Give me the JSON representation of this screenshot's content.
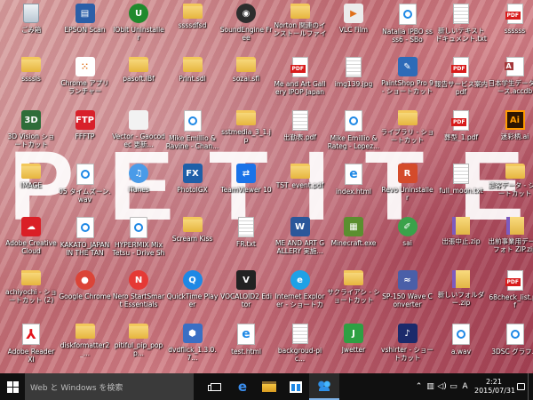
{
  "wallpaper": {
    "letters": [
      "P",
      "E",
      "T",
      "I",
      "T",
      "E"
    ]
  },
  "desktop": {
    "icons": [
      {
        "label": "ごみ箱",
        "glyph": "recycle-bin-icon",
        "style": "g-recycle",
        "text": ""
      },
      {
        "label": "EPSON Scan",
        "glyph": "scanner-icon",
        "style": "g-square",
        "color": "#2b5fa8",
        "text": "▤"
      },
      {
        "label": "IObit Uninstaller",
        "glyph": "iobit-uninstaller-icon",
        "style": "g-round",
        "color": "#1f8a2c",
        "text": "U"
      },
      {
        "label": "ssssdfsd",
        "glyph": "folder-icon",
        "style": "g-folder",
        "text": ""
      },
      {
        "label": "SoundEngine Free",
        "glyph": "soundengine-icon",
        "style": "g-round",
        "color": "#2d2d2d",
        "text": "◉"
      },
      {
        "label": "Norton 関連のイ ンストールファイル",
        "glyph": "folder-icon",
        "style": "g-folder",
        "text": ""
      },
      {
        "label": "VLC Film",
        "glyph": "vlc-file-icon",
        "style": "g-square",
        "color": "#ececec",
        "text": "▶"
      },
      {
        "label": "Natalia IPBO ssss6 - SBo",
        "glyph": "media-file-icon",
        "style": "g-media",
        "text": ""
      },
      {
        "label": "新しいテキスト ドキュメント.txt",
        "glyph": "text-file-icon",
        "style": "g-doc",
        "text": ""
      },
      {
        "label": "ssssss",
        "glyph": "pdf-file-icon",
        "style": "g-pdf",
        "text": ""
      },
      {
        "label": "ssssls",
        "glyph": "folder-icon",
        "style": "g-folder",
        "text": ""
      },
      {
        "label": "Chrome アプリ ランチャー",
        "glyph": "app-launcher-icon",
        "style": "g-square",
        "color": "#ffffff",
        "text": "⁙"
      },
      {
        "label": "pasoft.lBf",
        "glyph": "folder-icon",
        "style": "g-folder",
        "text": ""
      },
      {
        "label": "Print.sdl",
        "glyph": "folder-icon",
        "style": "g-folder",
        "text": ""
      },
      {
        "label": "sozai.sfl",
        "glyph": "folder-icon",
        "style": "g-folder",
        "text": ""
      },
      {
        "label": "Me and Art Gallery IPOP Japan voice...",
        "glyph": "pdf-file-icon",
        "style": "g-pdf",
        "text": ""
      },
      {
        "label": "img139.jpg",
        "glyph": "image-file-icon",
        "style": "g-doc",
        "text": ""
      },
      {
        "label": "PaintShop Pro 9 - ショートカット",
        "glyph": "paintshop-pro-icon",
        "style": "g-square",
        "color": "#2d6bb8",
        "text": "✎"
      },
      {
        "label": "報告サービス案内 pdf",
        "glyph": "pdf-file-icon",
        "style": "g-pdf",
        "text": ""
      },
      {
        "label": "日本学生データベース.accdb",
        "glyph": "access-file-icon",
        "style": "g-access",
        "text": ""
      },
      {
        "label": "3D Vision ショートカット",
        "glyph": "3d-vision-icon",
        "style": "g-square",
        "color": "#2f6d39",
        "text": "3D"
      },
      {
        "label": "FFFTP",
        "glyph": "ffftp-icon",
        "style": "g-square",
        "color": "#d8202a",
        "text": "FTP"
      },
      {
        "label": "Vector - Gaocodec 更新...",
        "glyph": "web-shortcut-icon",
        "style": "g-square",
        "color": "#f2f2f2",
        "text": ""
      },
      {
        "label": "Mike Emillio & Ravine - Chan...",
        "glyph": "media-file-icon",
        "style": "g-media",
        "text": ""
      },
      {
        "label": "sstmedia_3_1.jp",
        "glyph": "folder-icon",
        "style": "g-folder",
        "text": ""
      },
      {
        "label": "出勤表.pdf",
        "glyph": "text-file-icon",
        "style": "g-doc",
        "text": ""
      },
      {
        "label": "Mike Emillio & Rateg - Lopez...",
        "glyph": "media-file-icon",
        "style": "g-media",
        "text": ""
      },
      {
        "label": "ライブラリ - ショートカット",
        "glyph": "libraries-icon",
        "style": "g-folder",
        "text": ""
      },
      {
        "label": "葬型_1.pdf",
        "glyph": "pdf-file-icon",
        "style": "g-pdf",
        "text": ""
      },
      {
        "label": "迷彩柄.ai",
        "glyph": "illustrator-file-icon",
        "style": "g-ai",
        "text": "Ai"
      },
      {
        "label": "IMAGE",
        "glyph": "folder-icon",
        "style": "g-folder",
        "text": ""
      },
      {
        "label": "05 タイムズーン.wav",
        "glyph": "media-file-icon",
        "style": "g-media",
        "text": ""
      },
      {
        "label": "iTunes",
        "glyph": "itunes-icon",
        "style": "g-round",
        "color": "#4a9be8",
        "text": "♫"
      },
      {
        "label": "PhotoIGX",
        "glyph": "photo-app-icon",
        "style": "g-square",
        "color": "#1f5fa8",
        "text": "FX"
      },
      {
        "label": "TeamViewer 10",
        "glyph": "teamviewer-icon",
        "style": "g-square",
        "color": "#1a73e8",
        "text": "⇄"
      },
      {
        "label": "TST_event.pdf",
        "glyph": "folder-icon",
        "style": "g-folder",
        "text": ""
      },
      {
        "label": "index.html",
        "glyph": "web-file-icon",
        "style": "g-html",
        "text": "e"
      },
      {
        "label": "Revo Uninstaller",
        "glyph": "revo-uninstaller-icon",
        "style": "g-square",
        "color": "#d44b2b",
        "text": "R"
      },
      {
        "label": "full_moon.txt",
        "glyph": "text-file-icon",
        "style": "g-doc",
        "text": ""
      },
      {
        "label": "顧客データ - ショートカット",
        "glyph": "folder-icon",
        "style": "g-folder",
        "text": ""
      },
      {
        "label": "Adobe Creative Cloud",
        "glyph": "creative-cloud-icon",
        "style": "g-square",
        "color": "#da1f26",
        "text": "☁"
      },
      {
        "label": "KAKATO_JAPAN IN THE TAN",
        "glyph": "media-file-icon",
        "style": "g-media",
        "text": ""
      },
      {
        "label": "HYPERMIX Mix Tetsu - Drive Sho...",
        "glyph": "media-file-icon",
        "style": "g-media",
        "text": ""
      },
      {
        "label": "Scream Kiss",
        "glyph": "folder-icon",
        "style": "g-folder",
        "text": ""
      },
      {
        "label": "FR.txt",
        "glyph": "text-file-icon",
        "style": "g-doc",
        "text": ""
      },
      {
        "label": "ME AND ART GALLERY 実施...",
        "glyph": "word-file-icon",
        "style": "g-square",
        "color": "#2b579a",
        "text": "W"
      },
      {
        "label": "Minecraft.exe",
        "glyph": "minecraft-icon",
        "style": "g-square",
        "color": "#5b8f2f",
        "text": "▦"
      },
      {
        "label": "sai",
        "glyph": "sai-app-icon",
        "style": "g-round",
        "color": "#3aa24a",
        "text": "✐"
      },
      {
        "label": "出張中止.zip",
        "glyph": "zip-file-icon",
        "style": "g-zip",
        "text": ""
      },
      {
        "label": "出前事業用データフォト ZIP.zip",
        "glyph": "zip-file-icon",
        "style": "g-zip",
        "text": ""
      },
      {
        "label": "achiyochi - ショートカット (2)",
        "glyph": "folder-icon",
        "style": "g-folder",
        "text": ""
      },
      {
        "label": "Google Chrome",
        "glyph": "chrome-icon",
        "style": "g-round",
        "color": "#db4437",
        "text": "●"
      },
      {
        "label": "Nero StartSmart Essentials",
        "glyph": "nero-icon",
        "style": "g-round",
        "color": "#e53935",
        "text": "N"
      },
      {
        "label": "QuickTime Player",
        "glyph": "quicktime-icon",
        "style": "g-round",
        "color": "#1e88e5",
        "text": "Q"
      },
      {
        "label": "VOCALOID2 Editor",
        "glyph": "vocaloid-icon",
        "style": "g-square",
        "color": "#222222",
        "text": "V"
      },
      {
        "label": "Internet Explorer - ショートカット",
        "glyph": "internet-explorer-icon",
        "style": "g-round",
        "color": "#1ea1e6",
        "text": "e"
      },
      {
        "label": "サクライアシ - ショートカット",
        "glyph": "folder-icon",
        "style": "g-folder",
        "text": ""
      },
      {
        "label": "SP-150 Wave Converter",
        "glyph": "converter-icon",
        "style": "g-square",
        "color": "#4a5fa8",
        "text": "≈"
      },
      {
        "label": "新しいフォルダー.zip",
        "glyph": "zip-file-icon",
        "style": "g-zip",
        "text": ""
      },
      {
        "label": "68check_list.pdf",
        "glyph": "pdf-file-icon",
        "style": "g-pdf",
        "text": ""
      },
      {
        "label": "Adobe Reader XI",
        "glyph": "acrobat-reader-icon",
        "style": "g-acrobat",
        "text": "⅄"
      },
      {
        "label": "diskformatter2_...",
        "glyph": "folder-icon",
        "style": "g-folder",
        "text": ""
      },
      {
        "label": "pitiful_pip_popp...",
        "glyph": "folder-icon",
        "style": "g-folder",
        "text": ""
      },
      {
        "label": "dvdflick_1.3.0.7...",
        "glyph": "installer-icon",
        "style": "g-square",
        "color": "#3a6fc4",
        "text": "⬢"
      },
      {
        "label": "test.html",
        "glyph": "web-file-icon",
        "style": "g-html",
        "text": "e"
      },
      {
        "label": "backgroud-pic...",
        "glyph": "text-file-icon",
        "style": "g-doc",
        "text": ""
      },
      {
        "label": "Jwetter",
        "glyph": "jwetter-icon",
        "style": "g-square",
        "color": "#2ea043",
        "text": "J"
      },
      {
        "label": "vshirter - ショートカット",
        "glyph": "music-app-icon",
        "style": "g-square",
        "color": "#1b2a6b",
        "text": "♪"
      },
      {
        "label": "a.wav",
        "glyph": "media-file-icon",
        "style": "g-media",
        "text": ""
      },
      {
        "label": "3DSC グラフ...",
        "glyph": "media-file-icon",
        "style": "g-media",
        "text": ""
      }
    ]
  },
  "taskbar": {
    "search_placeholder": "Web と Windows を検索",
    "clock_time": "2:21",
    "clock_date": "2015/07/31",
    "ime_indicator": "A"
  }
}
